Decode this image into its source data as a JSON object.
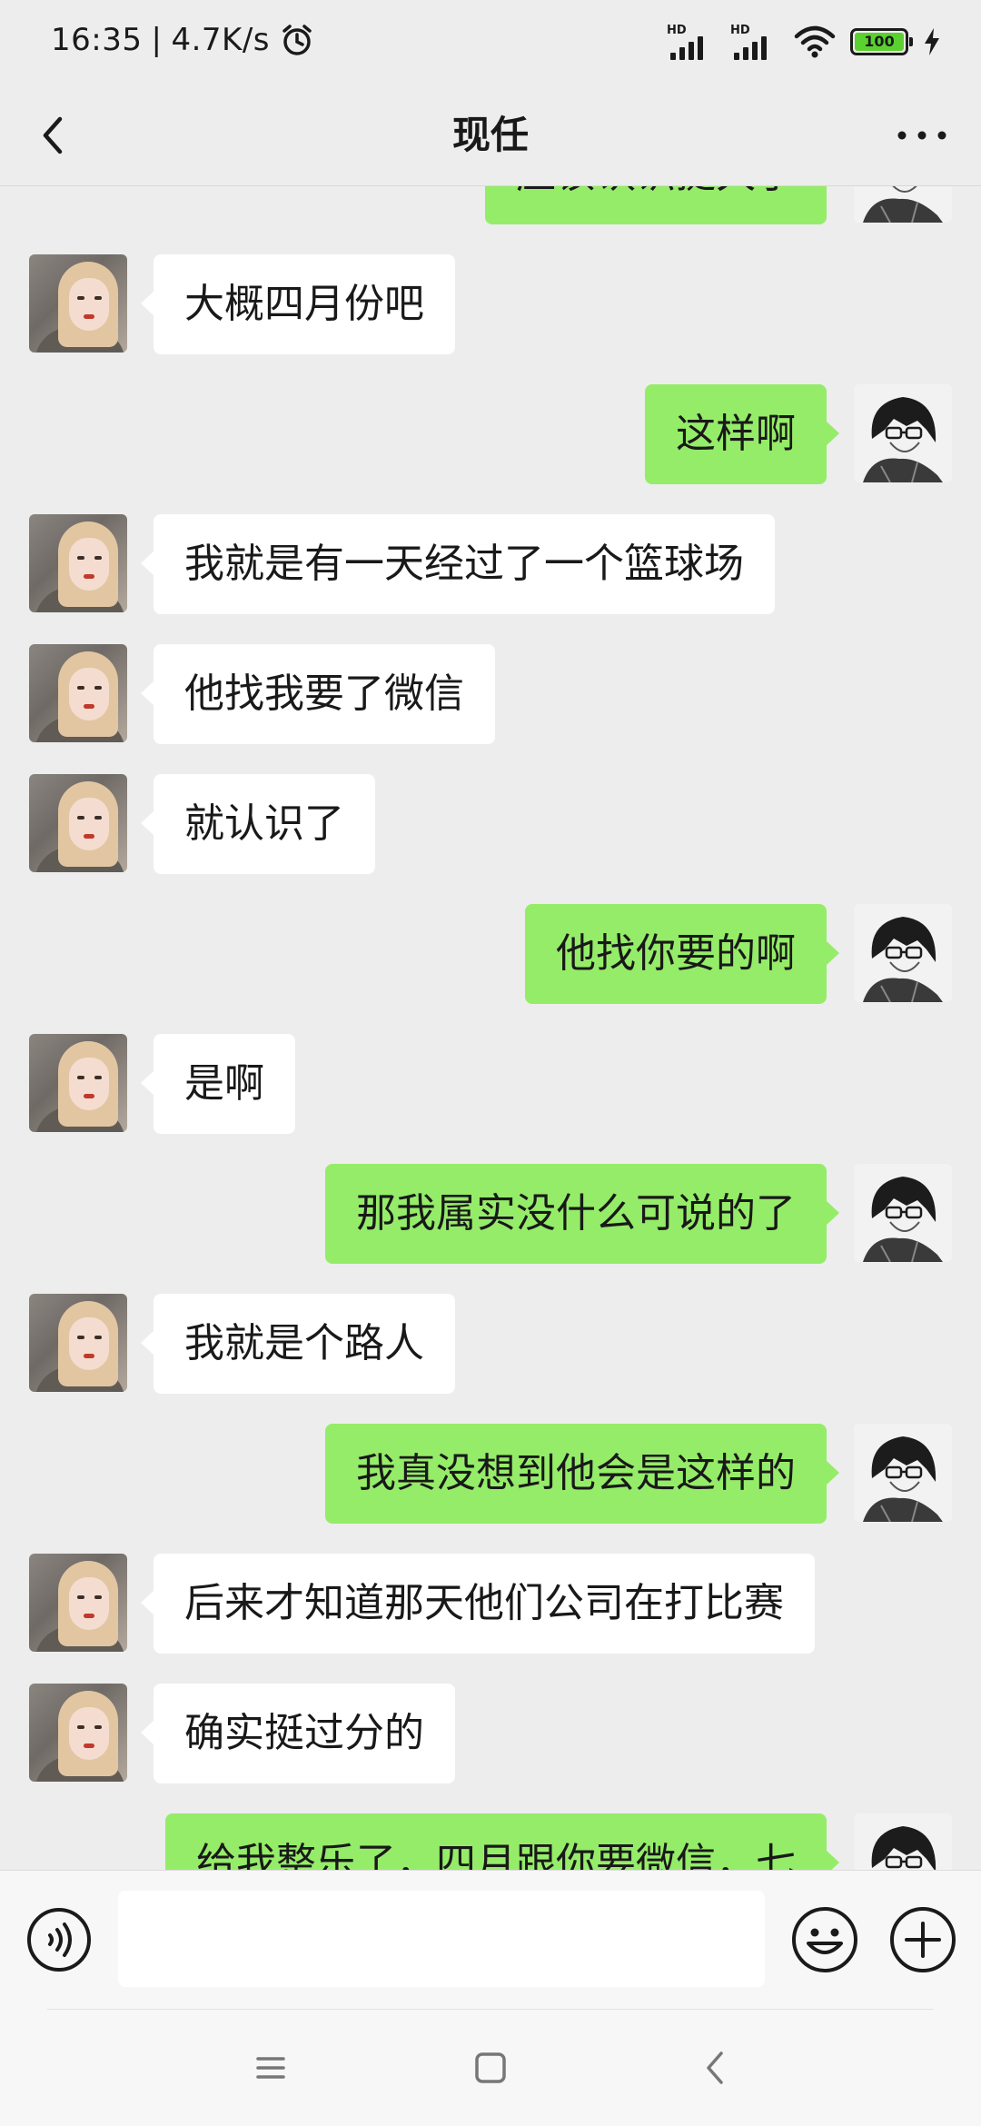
{
  "status_bar": {
    "time": "16:35",
    "separator": "|",
    "speed": "4.7K/s",
    "battery": "100",
    "alarm_icon": "alarm-clock-icon",
    "signal_label": "HD",
    "wifi_icon": "wifi-icon",
    "charging_icon": "lightning-bolt-icon"
  },
  "header": {
    "title": "现任",
    "back_icon": "chevron-left-icon",
    "more_icon": "ellipsis-icon"
  },
  "messages": [
    {
      "side": "right",
      "text": "应该认识挺久了"
    },
    {
      "side": "left",
      "text": "大概四月份吧"
    },
    {
      "side": "right",
      "text": "这样啊"
    },
    {
      "side": "left",
      "text": "我就是有一天经过了一个篮球场"
    },
    {
      "side": "left",
      "text": "他找我要了微信"
    },
    {
      "side": "left",
      "text": "就认识了"
    },
    {
      "side": "right",
      "text": "他找你要的啊"
    },
    {
      "side": "left",
      "text": "是啊"
    },
    {
      "side": "right",
      "text": "那我属实没什么可说的了"
    },
    {
      "side": "left",
      "text": "我就是个路人"
    },
    {
      "side": "right",
      "text": "我真没想到他会是这样的"
    },
    {
      "side": "left",
      "text": "后来才知道那天他们公司在打比赛"
    },
    {
      "side": "left",
      "text": "确实挺过分的"
    },
    {
      "side": "right",
      "text": "给我整乐了，四月跟你要微信，七"
    }
  ],
  "input_bar": {
    "value": "",
    "voice_icon": "voice-icon",
    "emoji_icon": "emoji-icon",
    "plus_icon": "plus-icon"
  },
  "nav": {
    "menu_icon": "menu-icon",
    "home_icon": "home-icon",
    "back_icon": "back-icon"
  },
  "colors": {
    "background": "#ededed",
    "outgoing_bubble": "#95ec69",
    "incoming_bubble": "#ffffff",
    "battery_fill": "#5ad130"
  }
}
